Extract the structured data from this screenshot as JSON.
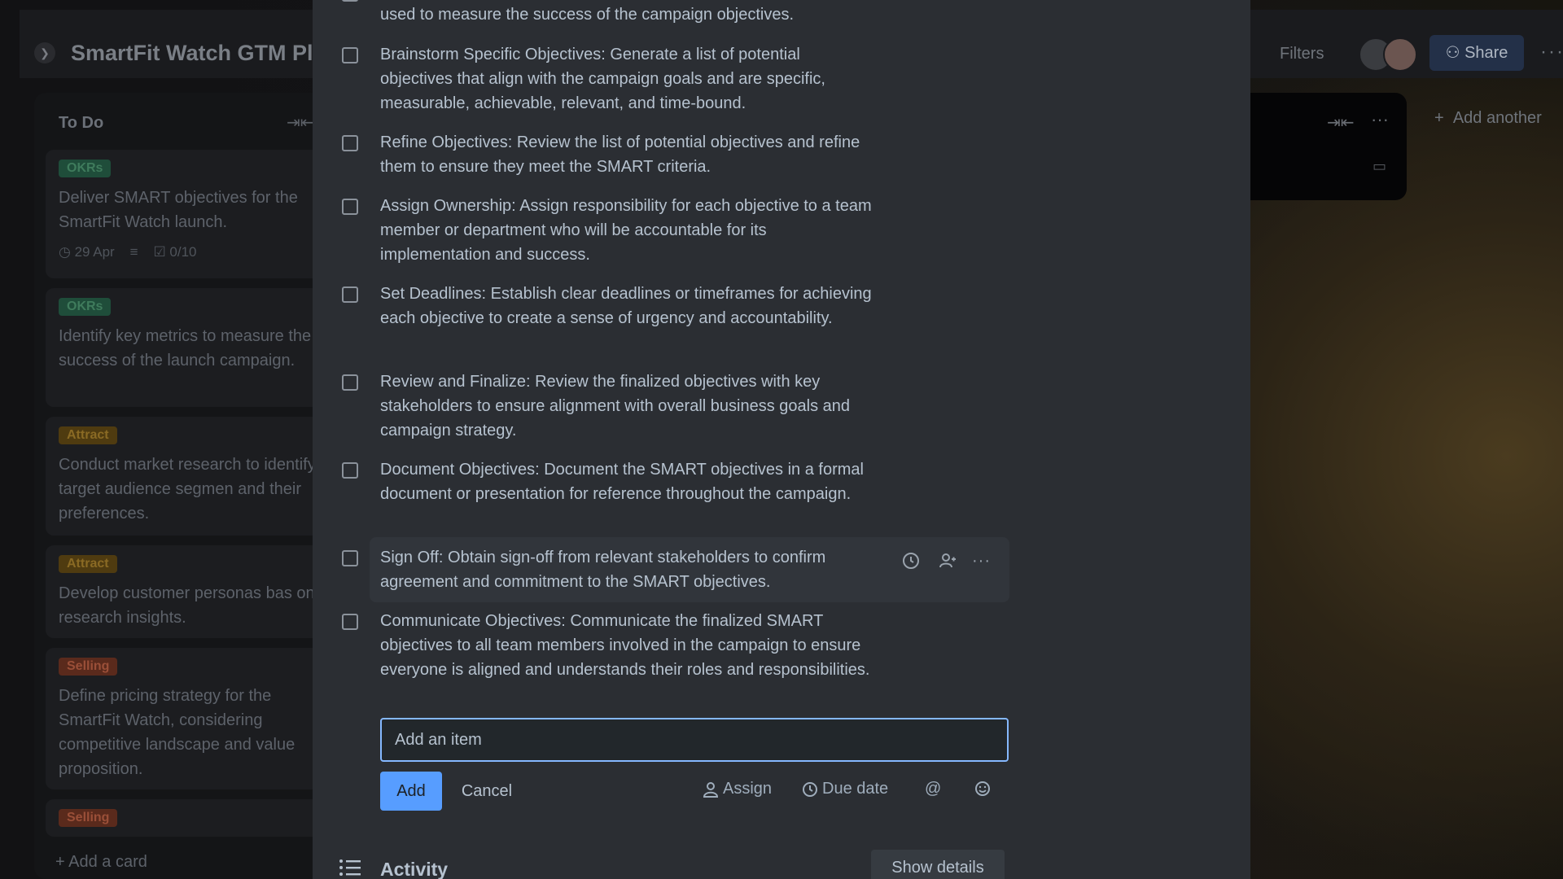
{
  "board": {
    "title": "SmartFit Watch GTM Plar",
    "filters_label": "Filters",
    "share_label": "Share",
    "add_list_label": "Add another",
    "todo_list": {
      "title": "To Do",
      "add_card_label": "Add a card",
      "cards": [
        {
          "label": "OKRs",
          "label_color": "#1f4d3a",
          "label_text_color": "#3f7b5c",
          "text": "Deliver SMART objectives for the SmartFit Watch launch.",
          "date": "29 Apr",
          "checklist": "0/10"
        },
        {
          "label": "OKRs",
          "label_color": "#1f4d3a",
          "label_text_color": "#3f7b5c",
          "text": "Identify key metrics to measure the success of the launch campaign."
        },
        {
          "label": "Attract",
          "label_color": "#4f3b10",
          "label_text_color": "#8a6a24",
          "text": "Conduct market research to identify target audience segmen and their preferences."
        },
        {
          "label": "Attract",
          "label_color": "#4f3b10",
          "label_text_color": "#8a6a24",
          "text": "Develop customer personas bas on research insights."
        },
        {
          "label": "Selling",
          "label_color": "#5a2a1c",
          "label_text_color": "#9a4f38",
          "text": "Define pricing strategy for the SmartFit Watch, considering competitive landscape and value proposition."
        },
        {
          "label": "Selling",
          "label_color": "#5a2a1c",
          "label_text_color": "#9a4f38",
          "text": ""
        }
      ]
    }
  },
  "checklist": {
    "partial_top_text": "used to measure the success of the campaign objectives.",
    "items": [
      {
        "text": "Brainstorm Specific Objectives: Generate a list of potential objectives that align with the campaign goals and are specific, measurable, achievable, relevant, and time-bound."
      },
      {
        "text": "Refine Objectives: Review the list of potential objectives and refine them to ensure they meet the SMART criteria."
      },
      {
        "text": "Assign Ownership: Assign responsibility for each objective to a team member or department who will be accountable for its implementation and success."
      },
      {
        "text": "Set Deadlines: Establish clear deadlines or timeframes for achieving each objective to create a sense of urgency and accountability."
      },
      {
        "text": "Review and Finalize: Review the finalized objectives with key stakeholders to ensure alignment with overall business goals and campaign strategy."
      },
      {
        "text": "Document Objectives: Document the SMART objectives in a formal document or presentation for reference throughout the campaign."
      },
      {
        "text": "Sign Off: Obtain sign-off from relevant stakeholders to confirm agreement and commitment to the SMART objectives."
      },
      {
        "text": "Communicate Objectives: Communicate the finalized SMART objectives to all team members involved in the campaign to ensure everyone is aligned and understands their roles and responsibilities."
      }
    ],
    "add_item": {
      "placeholder": "Add an item",
      "add_label": "Add",
      "cancel_label": "Cancel",
      "assign_label": "Assign",
      "due_date_label": "Due date"
    }
  },
  "activity": {
    "title": "Activity",
    "show_details_label": "Show details"
  },
  "colors": {
    "modal_bg": "#2b2e33",
    "accent": "#579dff",
    "input_border": "#85b8ff",
    "text": "#b6c2cf"
  }
}
